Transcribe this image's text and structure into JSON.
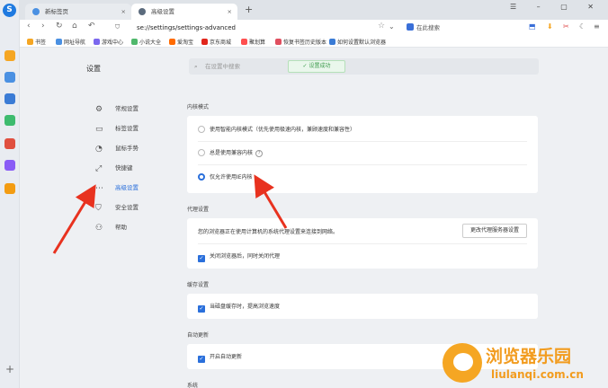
{
  "tabs": [
    {
      "label": "新标签页",
      "fav_color": "#4a90e2"
    },
    {
      "label": "高级设置",
      "fav_color": "#5b6b7d"
    }
  ],
  "toolbar": {
    "address": "se://settings/settings-advanced",
    "search_placeholder": "在此搜索"
  },
  "bookmarks": [
    {
      "label": "书签",
      "color": "#f5a623"
    },
    {
      "label": "网址导航",
      "color": "#4a90e2"
    },
    {
      "label": "游戏中心",
      "color": "#7b68ee"
    },
    {
      "label": "小说大全",
      "color": "#50b86c"
    },
    {
      "label": "爱淘宝",
      "color": "#ff6a00"
    },
    {
      "label": "京东商城",
      "color": "#e1251b"
    },
    {
      "label": "聚划算",
      "color": "#ff4f4f"
    },
    {
      "label": "恢复书签历史版本",
      "color": "#e04f5f"
    },
    {
      "label": "如何设置默认浏览器",
      "color": "#3a7bd5"
    }
  ],
  "settings": {
    "title": "设置",
    "search_placeholder": "在设置中搜索",
    "toast": "设置成功"
  },
  "nav": [
    {
      "label": "常规设置",
      "icon": "⚙"
    },
    {
      "label": "标签设置",
      "icon": "▭"
    },
    {
      "label": "鼠标手势",
      "icon": "◔"
    },
    {
      "label": "快捷键",
      "icon": "⤢"
    },
    {
      "label": "高级设置",
      "icon": "⋯"
    },
    {
      "label": "安全设置",
      "icon": "⛉"
    },
    {
      "label": "帮助",
      "icon": "⚇"
    }
  ],
  "kernel": {
    "heading": "内核模式",
    "opt1": "使用智能内核模式（优先使用极速内核，兼顾速度和兼容性）",
    "opt2": "总是使用兼容内核",
    "opt3": "仅允许使用IE内核"
  },
  "proxy": {
    "heading": "代理设置",
    "desc": "您的浏览器正在使用计算机的系统代理设置来连接到网络。",
    "button": "更改代理服务器设置",
    "check": "关闭浏览器后，同时关闭代理"
  },
  "cache": {
    "heading": "缓存设置",
    "check": "当磁盘缓存时，提高浏览速度"
  },
  "autoupdate": {
    "heading": "自动更新",
    "check": "开启自动更新"
  },
  "system": {
    "heading": "系统"
  },
  "watermark": {
    "title": "浏览器乐园",
    "url": "liulanqi.com.cn"
  }
}
